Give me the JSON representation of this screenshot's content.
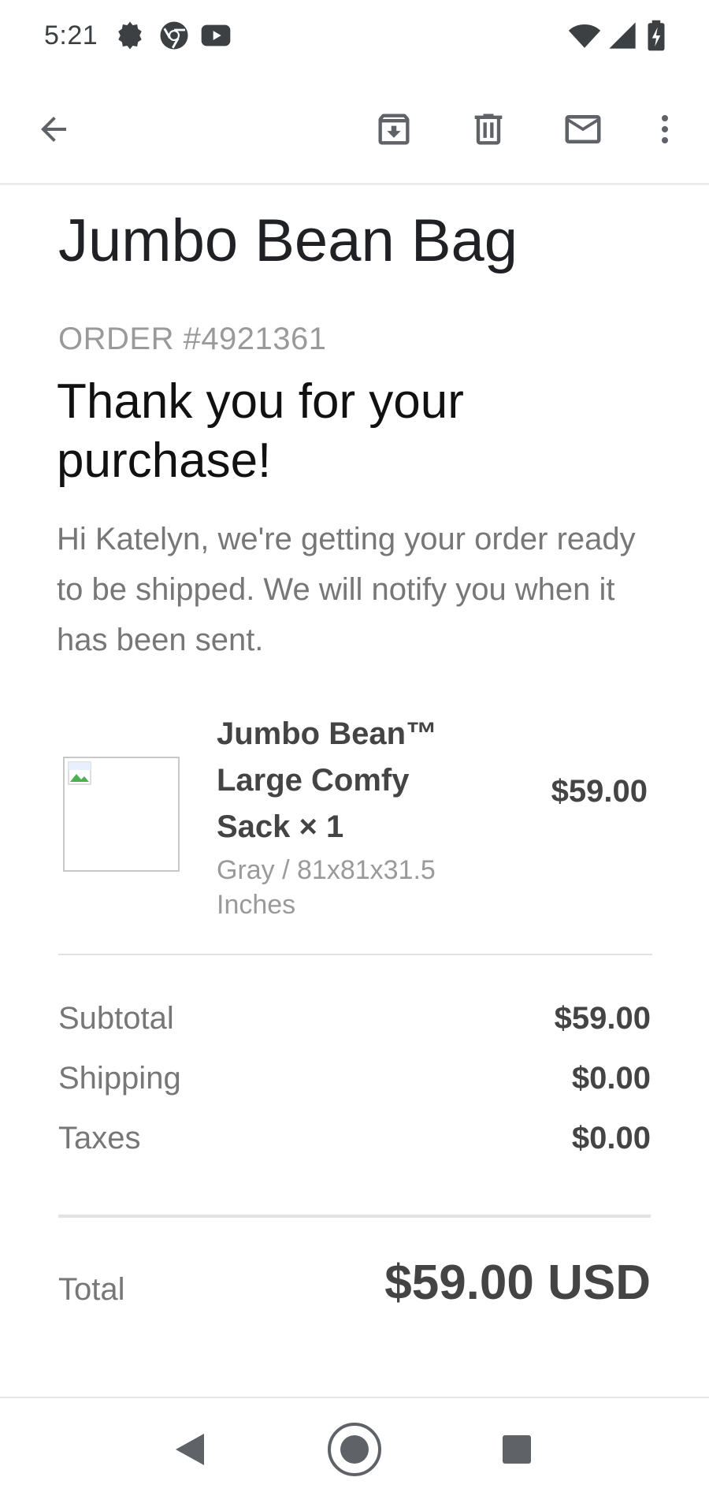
{
  "status": {
    "time": "5:21"
  },
  "email": {
    "subject": "Jumbo Bean Bag",
    "order_number": "ORDER #4921361",
    "headline": "Thank you for your purchase!",
    "intro": "Hi Katelyn, we're getting your order ready to be shipped. We will notify you when it has been sent."
  },
  "item": {
    "name": "Jumbo Bean™ Large Comfy Sack × 1",
    "variant": "Gray / 81x81x31.5 Inches",
    "price": "$59.00"
  },
  "summary": {
    "rows": [
      {
        "label": "Subtotal",
        "value": "$59.00"
      },
      {
        "label": "Shipping",
        "value": "$0.00"
      },
      {
        "label": "Taxes",
        "value": "$0.00"
      }
    ],
    "total_label": "Total",
    "total_value": "$59.00 USD"
  },
  "icons": {
    "status": [
      "settings-icon",
      "chrome-icon",
      "youtube-icon",
      "wifi-icon",
      "signal-icon",
      "battery-icon"
    ],
    "toolbar": [
      "back-arrow-icon",
      "archive-icon",
      "delete-icon",
      "mark-unread-icon",
      "more-vert-icon"
    ],
    "nav": [
      "nav-back-icon",
      "nav-home-icon",
      "nav-recents-icon"
    ]
  },
  "colors": {
    "text_dark": "#202124",
    "text_muted": "#777777",
    "icon": "#5f6368"
  }
}
